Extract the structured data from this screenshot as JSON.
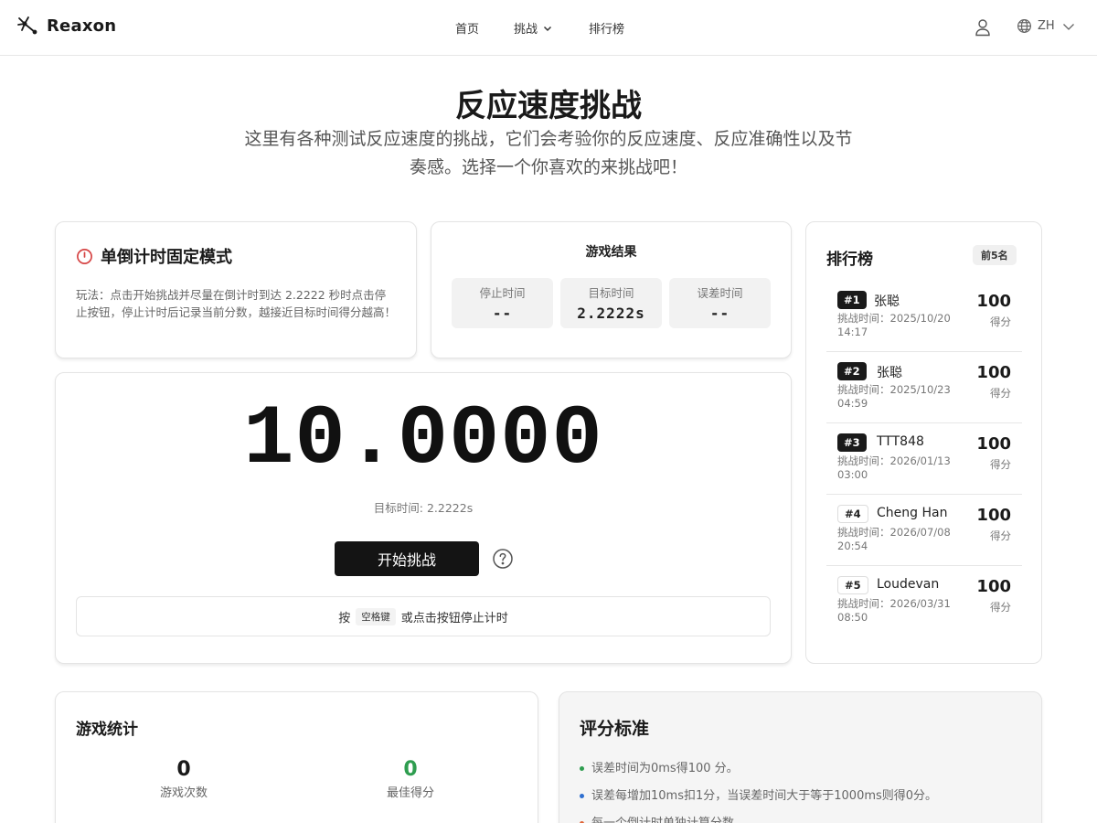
{
  "header": {
    "brand": "Reaxon",
    "nav": {
      "home": "首页",
      "challenge": "挑战",
      "leaderboard": "排行榜"
    },
    "lang": "ZH"
  },
  "hero": {
    "title": "反应速度挑战",
    "subtitle": "这里有各种测试反应速度的挑战，它们会考验你的反应速度、反应准确性以及节奏感。选择一个你喜欢的来挑战吧！"
  },
  "mode": {
    "title": "单倒计时固定模式",
    "description": "玩法：点击开始挑战并尽量在倒计时到达 2.2222 秒时点击停止按钮，停止计时后记录当前分数，越接近目标时间得分越高！"
  },
  "result": {
    "title": "游戏结果",
    "boxes": [
      {
        "label": "停止时间",
        "value": "--"
      },
      {
        "label": "目标时间",
        "value": "2.2222s"
      },
      {
        "label": "误差时间",
        "value": "--"
      }
    ]
  },
  "timer": {
    "value": "10.0000",
    "target": "目标时间: 2.2222s",
    "start_label": "开始挑战",
    "hint_prefix": "按",
    "hint_key": "空格键",
    "hint_suffix": "或点击按钮停止计时"
  },
  "leaderboard": {
    "title": "排行榜",
    "badge": "前5名",
    "entries": [
      {
        "rank": "#1",
        "name": "张聪",
        "time": "挑战时间：2025/10/20 14:17",
        "score": "100",
        "unit": "得分"
      },
      {
        "rank": "#2",
        "name": "张聪",
        "time": "挑战时间：2025/10/23 04:59",
        "score": "100",
        "unit": "得分"
      },
      {
        "rank": "#3",
        "name": "TTT848",
        "time": "挑战时间：2026/01/13 03:00",
        "score": "100",
        "unit": "得分"
      },
      {
        "rank": "#4",
        "name": "Cheng Han",
        "time": "挑战时间：2026/07/08 20:54",
        "score": "100",
        "unit": "得分"
      },
      {
        "rank": "#5",
        "name": "Loudevan",
        "time": "挑战时间：2026/03/31 08:50",
        "score": "100",
        "unit": "得分"
      }
    ]
  },
  "stats": {
    "title": "游戏统计",
    "items": [
      {
        "value": "0",
        "label": "游戏次数",
        "color": "#1a1a1a"
      },
      {
        "value": "0",
        "label": "最佳得分",
        "color": "#2e9d4f"
      }
    ]
  },
  "rules": {
    "title": "评分标准",
    "items": [
      {
        "text": "误差时间为0ms得100 分。",
        "color": "#2e9d4f"
      },
      {
        "text": "误差每增加10ms扣1分，当误差时间大于等于1000ms则得0分。",
        "color": "#2f6fd0"
      },
      {
        "text": "每一个倒计时单独计算分数",
        "color": "#e0663a"
      }
    ]
  },
  "colors": {
    "accent_dark": "#141414",
    "mode_icon": "#d64545",
    "success": "#2e9d4f"
  }
}
